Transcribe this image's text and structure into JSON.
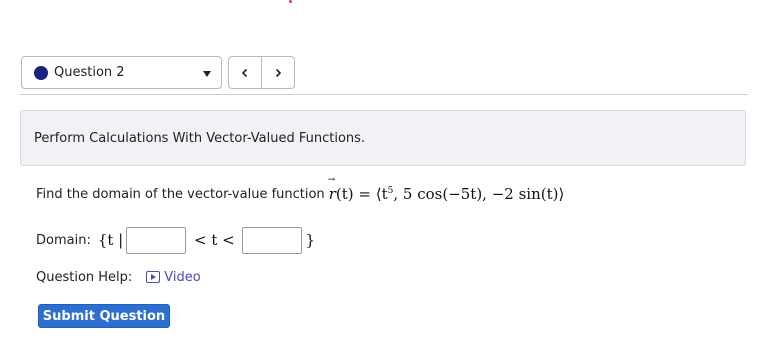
{
  "question_select": {
    "label": "Question 2",
    "status_color": "#1a237e"
  },
  "nav": {
    "prev_icon": "chevron-left-icon",
    "next_icon": "chevron-right-icon"
  },
  "banner": {
    "title": "Perform Calculations With Vector-Valued Functions."
  },
  "prompt": {
    "text": "Find the domain of the vector-value function",
    "formula_lhs": "r",
    "formula_arg": "(t) =",
    "formula_open": "⟨t",
    "formula_exp": "5",
    "formula_rest": ", 5 cos(−5t), −2 sin(t)⟩"
  },
  "domain": {
    "label": "Domain:",
    "open": "{t |",
    "middle": " < t < ",
    "close": "}",
    "lower_value": "",
    "upper_value": ""
  },
  "help": {
    "label": "Question Help:",
    "video_label": "Video"
  },
  "submit_label": "Submit Question",
  "colors": {
    "accent": "#2c6fd1",
    "link": "#4a4bb8",
    "banner_bg": "#f1f2f5"
  }
}
